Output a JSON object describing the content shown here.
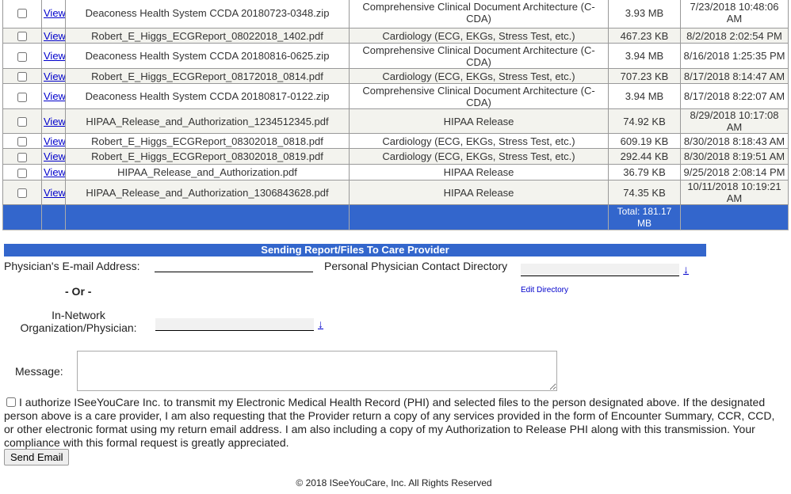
{
  "files": {
    "view_label": "View",
    "rows": [
      {
        "name": "Deaconess Health System CCDA 20180723-0348.zip",
        "type": "Comprehensive Clinical Document Architecture (C-CDA)",
        "size": "3.93 MB",
        "date": "7/23/2018 10:48:06 AM"
      },
      {
        "name": "Robert_E_Higgs_ECGReport_08022018_1402.pdf",
        "type": "Cardiology (ECG, EKGs, Stress Test, etc.)",
        "size": "467.23 KB",
        "date": "8/2/2018 2:02:54 PM"
      },
      {
        "name": "Deaconess Health System CCDA 20180816-0625.zip",
        "type": "Comprehensive Clinical Document Architecture (C-CDA)",
        "size": "3.94 MB",
        "date": "8/16/2018 1:25:35 PM"
      },
      {
        "name": "Robert_E_Higgs_ECGReport_08172018_0814.pdf",
        "type": "Cardiology (ECG, EKGs, Stress Test, etc.)",
        "size": "707.23 KB",
        "date": "8/17/2018 8:14:47 AM"
      },
      {
        "name": "Deaconess Health System CCDA 20180817-0122.zip",
        "type": "Comprehensive Clinical Document Architecture (C-CDA)",
        "size": "3.94 MB",
        "date": "8/17/2018 8:22:07 AM"
      },
      {
        "name": "HIPAA_Release_and_Authorization_1234512345.pdf",
        "type": "HIPAA Release",
        "size": "74.92 KB",
        "date": "8/29/2018 10:17:08 AM"
      },
      {
        "name": "Robert_E_Higgs_ECGReport_08302018_0818.pdf",
        "type": "Cardiology (ECG, EKGs, Stress Test, etc.)",
        "size": "609.19 KB",
        "date": "8/30/2018 8:18:43 AM"
      },
      {
        "name": "Robert_E_Higgs_ECGReport_08302018_0819.pdf",
        "type": "Cardiology (ECG, EKGs, Stress Test, etc.)",
        "size": "292.44 KB",
        "date": "8/30/2018 8:19:51 AM"
      },
      {
        "name": "HIPAA_Release_and_Authorization.pdf",
        "type": "HIPAA Release",
        "size": "36.79 KB",
        "date": "9/25/2018 2:08:14 PM"
      },
      {
        "name": "HIPAA_Release_and_Authorization_1306843628.pdf",
        "type": "HIPAA Release",
        "size": "74.35 KB",
        "date": "10/11/2018 10:19:21 AM"
      }
    ],
    "total": "Total: 181.17 MB"
  },
  "send": {
    "title": "Sending Report/Files To Care Provider",
    "email_label": "Physician's E-mail Address:",
    "email_value": "",
    "directory_label": "Personal Physician Contact Directory",
    "edit_directory": "Edit Directory",
    "or": "- Or -",
    "network_label_1": "In-Network",
    "network_label_2": "Organization/Physician:",
    "message_label": "Message:",
    "message_value": "",
    "authorization": "I authorize ISeeYouCare Inc. to transmit my Electronic Medical Health Record (PHI) and selected files to the person designated above. If the designated person above is a care provider, I am also requesting that the Provider return a copy of any services provided in the form of Encounter Summary, CCR, CCD, or other electronic format using my return email address. I am also including a copy of my Authorization to Release PHI along with this transmission. Your compliance with this formal request is greatly appreciated.",
    "send_button": "Send Email",
    "dropdown_icon": "down-arrow-icon"
  },
  "footer": "© 2018 ISeeYouCare, Inc. All Rights Reserved",
  "colors": {
    "accent": "#3366cc",
    "link": "#0000cc"
  }
}
